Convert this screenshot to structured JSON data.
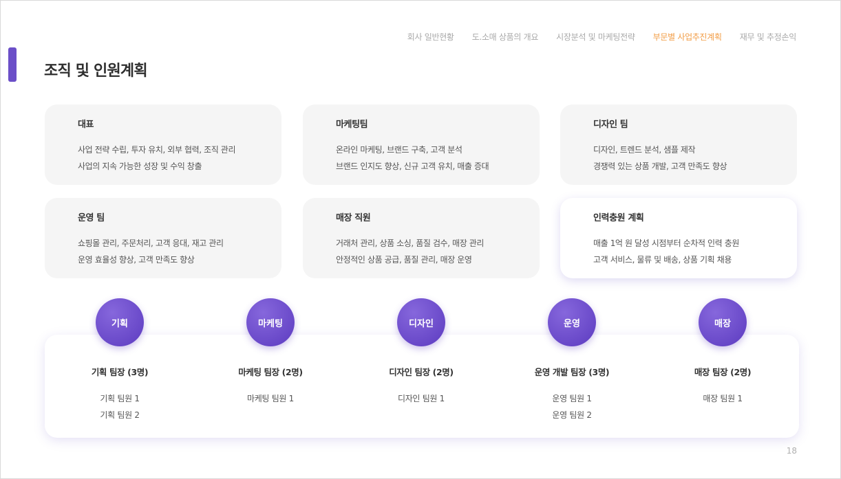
{
  "nav": {
    "items": [
      {
        "label": "회사 일반현황",
        "active": false
      },
      {
        "label": "도.소매 상품의 개요",
        "active": false
      },
      {
        "label": "시장분석 및 마케팅전략",
        "active": false
      },
      {
        "label": "부문별 사업추진계획",
        "active": true
      },
      {
        "label": "재무 및 추정손익",
        "active": false
      }
    ],
    "active_color": "#f29d46"
  },
  "page_title": "조직 및 인원계획",
  "cards": [
    {
      "title": "대표",
      "lines": [
        "사업 전략 수립, 투자 유치, 외부 협력, 조직 관리",
        "사업의 지속 가능한 성장 및 수익 창출"
      ]
    },
    {
      "title": "마케팅팀",
      "lines": [
        "온라인 마케팅, 브랜드 구축, 고객 분석",
        "브랜드 인지도 향상, 신규 고객 유치, 매출 증대"
      ]
    },
    {
      "title": "디자인 팀",
      "lines": [
        "디자인, 트렌드 분석, 샘플 제작",
        "경쟁력 있는 상품 개발, 고객 만족도 향상"
      ]
    },
    {
      "title": "운영 팀",
      "lines": [
        "쇼핑몰 관리, 주문처리, 고객 응대, 재고 관리",
        "운영 효율성 향상, 고객 만족도 향상"
      ]
    },
    {
      "title": "매장 직원",
      "lines": [
        "거래처 관리, 상품 소싱, 품질 검수, 매장 관리",
        "안정적인 상품 공급, 품질 관리, 매장 운영"
      ]
    },
    {
      "title": "인력충원 계획",
      "lines": [
        "매출 1억 원 달성 시점부터 순차적 인력 충원",
        "고객 서비스, 물류 및 배송, 상품 기획 채용"
      ]
    }
  ],
  "teams": [
    {
      "circle": "기획",
      "head": "기획 팀장 (3명)",
      "members": [
        "기획 팀원 1",
        "기획 팀원 2"
      ]
    },
    {
      "circle": "마케팅",
      "head": "마케팅 팀장 (2명)",
      "members": [
        "마케팅 팀원 1"
      ]
    },
    {
      "circle": "디자인",
      "head": "디자인 팀장 (2명)",
      "members": [
        "디자인 팀원 1"
      ]
    },
    {
      "circle": "운영",
      "head": "운영 개발 팀장 (3명)",
      "members": [
        "운영 팀원 1",
        "운영 팀원 2"
      ]
    },
    {
      "circle": "매장",
      "head": "매장 팀장 (2명)",
      "members": [
        "매장 팀원 1"
      ]
    }
  ],
  "page_number": "18",
  "colors": {
    "accent": "#6b4fc8",
    "circle": "#6a4bcf"
  }
}
